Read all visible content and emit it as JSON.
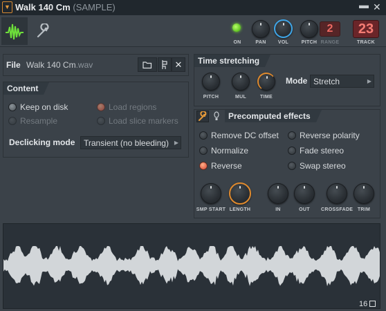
{
  "window": {
    "title": "Walk 140 Cm",
    "subtitle": "(SAMPLE)"
  },
  "toolbar": {
    "on_label": "ON",
    "pan_label": "PAN",
    "vol_label": "VOL",
    "pitch_label": "PITCH",
    "range_label": "RANGE",
    "range_value": "2",
    "track_label": "TRACK",
    "track_value": "23"
  },
  "file": {
    "label": "File",
    "name": "Walk 140 Cm",
    "ext": ".wav"
  },
  "content": {
    "header": "Content",
    "options": [
      {
        "label": "Keep on disk"
      },
      {
        "label": "Load regions"
      },
      {
        "label": "Resample"
      },
      {
        "label": "Load slice markers"
      }
    ],
    "declicking_label": "Declicking mode",
    "declicking_value": "Transient (no bleeding)"
  },
  "time_stretching": {
    "header": "Time stretching",
    "knobs": [
      "PITCH",
      "MUL",
      "TIME"
    ],
    "mode_label": "Mode",
    "mode_value": "Stretch"
  },
  "precomputed": {
    "header": "Precomputed effects",
    "effects": [
      {
        "label": "Remove DC offset"
      },
      {
        "label": "Reverse polarity"
      },
      {
        "label": "Normalize"
      },
      {
        "label": "Fade stereo"
      },
      {
        "label": "Reverse"
      },
      {
        "label": "Swap stereo"
      }
    ],
    "knobs": [
      "SMP START",
      "LENGTH",
      "IN",
      "OUT",
      "CROSSFADE",
      "TRIM"
    ]
  },
  "waveform": {
    "number": "16",
    "color": "#d2d6d9"
  },
  "colors": {
    "accent_orange": "#e08a2d",
    "accent_blue": "#3fa6e8",
    "led_green": "#6fd62a",
    "digit_red": "#ee6a63"
  }
}
